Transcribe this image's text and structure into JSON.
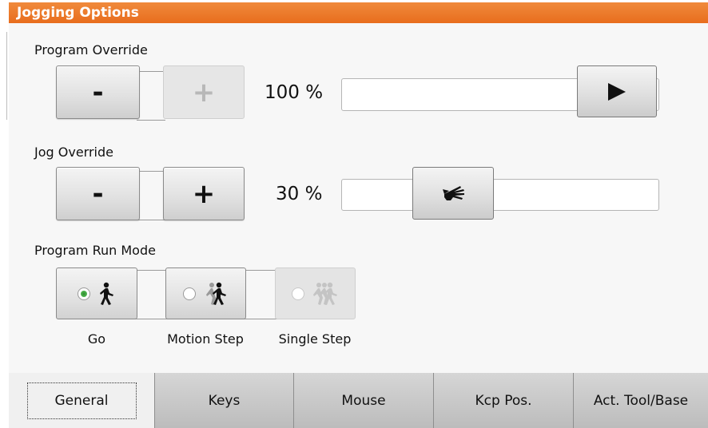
{
  "window": {
    "title": "Jogging Options"
  },
  "program_override": {
    "label": "Program Override",
    "minus_label": "-",
    "plus_label": "+",
    "value": "100 %",
    "level_percent": 100,
    "slider_icon": "play-triangle-icon"
  },
  "jog_override": {
    "label": "Jog Override",
    "minus_label": "-",
    "plus_label": "+",
    "value": "30 %",
    "level_percent": 30,
    "slider_icon": "hand-icon"
  },
  "run_mode": {
    "label": "Program Run Mode",
    "modes": [
      {
        "label": "Go",
        "selected": true,
        "enabled": true,
        "icon": "walking-figure-icon"
      },
      {
        "label": "Motion Step",
        "selected": false,
        "enabled": true,
        "icon": "motion-step-figure-icon"
      },
      {
        "label": "Single Step",
        "selected": false,
        "enabled": false,
        "icon": "single-step-figure-icon"
      }
    ]
  },
  "tabs": [
    {
      "label": "General",
      "active": true
    },
    {
      "label": "Keys",
      "active": false
    },
    {
      "label": "Mouse",
      "active": false
    },
    {
      "label": "Kcp Pos.",
      "active": false
    },
    {
      "label": "Act. Tool/Base",
      "active": false
    }
  ],
  "colors": {
    "title_bar": "#e8731f",
    "selected_radio": "#3a9c3a"
  }
}
